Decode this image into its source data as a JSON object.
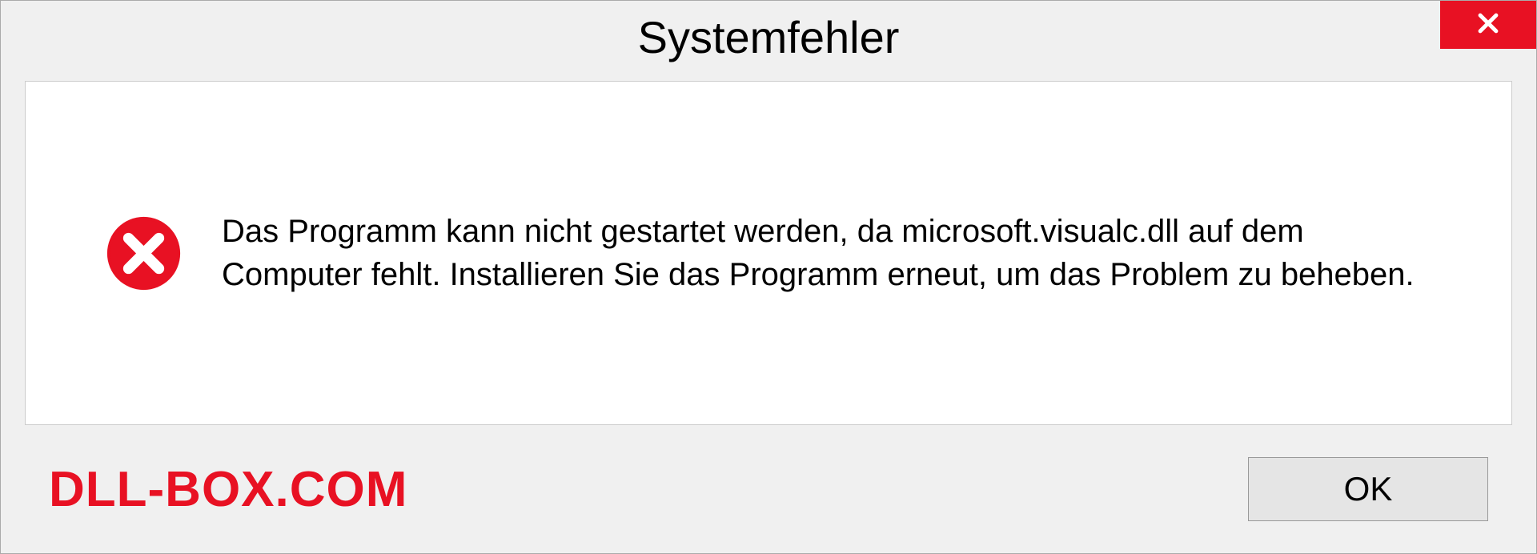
{
  "dialog": {
    "title": "Systemfehler",
    "message": "Das Programm kann nicht gestartet werden, da microsoft.visualc.dll auf dem Computer fehlt. Installieren Sie das Programm erneut, um das Problem zu beheben.",
    "ok_label": "OK"
  },
  "watermark": "DLL-BOX.COM",
  "colors": {
    "close_bg": "#e81123",
    "error_icon": "#e81123",
    "watermark": "#e81123"
  }
}
